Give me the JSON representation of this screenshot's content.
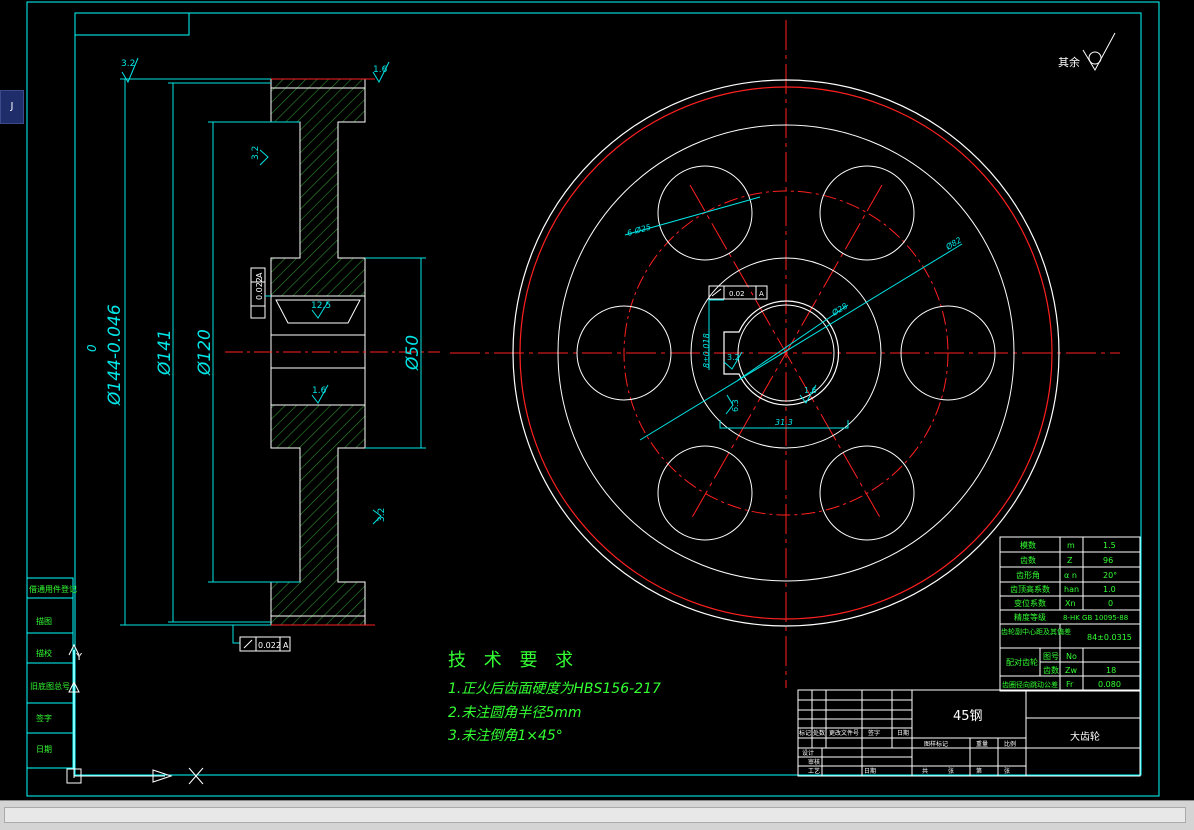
{
  "colors": {
    "background": "#000000",
    "frame": "#00ffff",
    "geometry": "#ffffff",
    "centerline": "#ff2020",
    "dimension": "#00e5e5",
    "hatch": "#2e8b2e",
    "note": "#33ff33",
    "table_text": "#33ff33"
  },
  "icons": {
    "side_tab": "drawing-tab-icon",
    "ucs": "ucs-axis-icon",
    "cursor": "crosshair-cursor-icon"
  },
  "side_tab": {
    "label": "J"
  },
  "section_view": {
    "dim_od": "Ø144-0.046",
    "dim_od_upper": "0",
    "dim_rim": "Ø141",
    "dim_web": "Ø120",
    "dim_bore": "Ø50",
    "rough_top": "3.2",
    "rough_face": "1.6",
    "rough_web": "3.2",
    "rough_keyway": "12.5",
    "rough_bore": "1.6",
    "rough_lower": "3.2",
    "gtol_upper_val": "0.022",
    "gtol_upper_datum": "A",
    "gtol_lower_val": "0.022",
    "gtol_lower_datum": "A"
  },
  "front_view": {
    "surface_note": "其余",
    "dim_holes": "6-Ø25",
    "dim_pcd": "Ø82",
    "dim_bore": "Ø28",
    "dim_keyway_width": "8±0.018",
    "dim_keyway_depth": "31.3",
    "rough_keyway": "3.2",
    "rough_bore": "1.6",
    "rough_key_side": "6.3",
    "gtol_val": "0.02",
    "gtol_datum": "A"
  },
  "tech_requirements": {
    "title": "技 术 要 求",
    "items": [
      "1.正火后齿面硬度为HBS156-217",
      "2.未注圆角半径5mm",
      "3.未注倒角1×45°"
    ]
  },
  "gear_params": {
    "rows": [
      {
        "label": "模数",
        "symbol": "m",
        "value": "1.5"
      },
      {
        "label": "齿数",
        "symbol": "Z",
        "value": "96"
      },
      {
        "label": "齿形角",
        "symbol": "α n",
        "value": "20°"
      },
      {
        "label": "齿顶高系数",
        "symbol": "han",
        "value": "1.0"
      },
      {
        "label": "变位系数",
        "symbol": "Xn",
        "value": "0"
      },
      {
        "label": "精度等级",
        "symbol": "",
        "value": "8-HK GB 10095-88"
      },
      {
        "label": "齿轮副中心距及其偏差",
        "symbol": "",
        "value": "84±0.0315"
      },
      {
        "label": "图号",
        "symbol": "No",
        "value": ""
      },
      {
        "label": "齿数",
        "symbol": "Zw",
        "value": "18"
      },
      {
        "label": "齿圈径向跳动公差",
        "symbol": "Fr",
        "value": "0.080"
      }
    ],
    "pair_label": "配对齿轮"
  },
  "title_block": {
    "material": "45钢",
    "part_name": "大齿轮",
    "headers": [
      "标记",
      "处数",
      "更改文件号",
      "签字",
      "日期"
    ],
    "right_headers": [
      "图样标记",
      "重量",
      "比例"
    ],
    "sheet": [
      "共",
      "张",
      "第",
      "张"
    ],
    "roles": [
      "设计",
      "审核",
      "工艺"
    ],
    "role_date": "日期"
  },
  "left_strip": {
    "items": [
      "借通用件登记",
      "描图",
      "描校",
      "旧底图总号",
      "签字",
      "日期"
    ]
  }
}
